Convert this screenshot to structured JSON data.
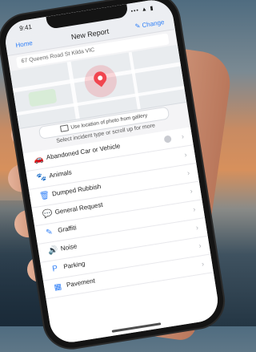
{
  "status_bar": {
    "time": "9:41",
    "signal": "••• ▲ ▮"
  },
  "nav": {
    "back_label": "Home",
    "title": "New Report",
    "change_label": "✎ Change"
  },
  "address": "67 Queens Road St Kilda VIC",
  "map": {
    "pin_color": "#f1454f"
  },
  "use_photo_button": "Use location of photo from gallery",
  "hint": "Select incident type or scroll up for more",
  "items": [
    {
      "label": "Abandoned Car or Vehicle",
      "icon": "car-icon",
      "glyph": "🚗"
    },
    {
      "label": "Animals",
      "icon": "paw-icon",
      "glyph": "🐾"
    },
    {
      "label": "Dumped Rubbish",
      "icon": "trash-icon",
      "glyph": "🗑"
    },
    {
      "label": "General Request",
      "icon": "chat-icon",
      "glyph": "💬"
    },
    {
      "label": "Graffiti",
      "icon": "spray-icon",
      "glyph": "✎"
    },
    {
      "label": "Noise",
      "icon": "speaker-icon",
      "glyph": "🔊"
    },
    {
      "label": "Parking",
      "icon": "parking-icon",
      "glyph": "P"
    },
    {
      "label": "Pavement",
      "icon": "pavement-icon",
      "glyph": "▦"
    }
  ],
  "accent_color": "#2f7ff7"
}
